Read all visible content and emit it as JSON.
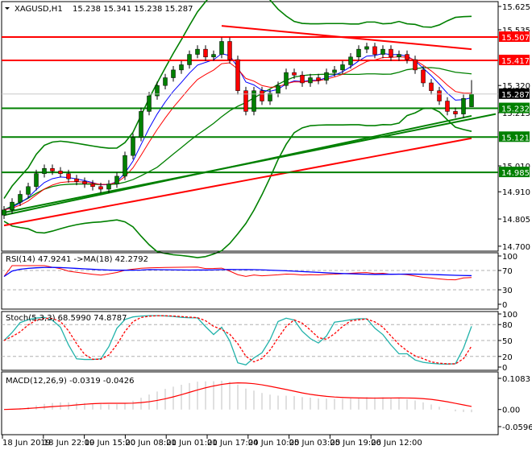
{
  "header": {
    "symbol": "XAGUSD,H1",
    "ohlc": "15.238 15.341 15.238 15.287"
  },
  "colors": {
    "bull": "#008000",
    "bear": "#ff0000",
    "support": "#008000",
    "resistance": "#ff0000",
    "bollinger": "#008000",
    "ma_fast": "#0000ff",
    "ma_slow": "#ff0000",
    "stoch_main": "#20b2aa",
    "stoch_signal": "#ff0000",
    "macd_hist": "#c0c0c0",
    "macd_signal": "#ff0000"
  },
  "chart_data": {
    "type": "candlestick",
    "title": "XAGUSD,H1",
    "ylim": [
      14.7,
      15.625
    ],
    "price_ticks": [
      "15.625",
      "15.535",
      "15.320",
      "15.215",
      "15.010",
      "14.910",
      "14.805",
      "14.700"
    ],
    "x_tick_labels": [
      "18 Jun 2019",
      "18 Jun 22:00",
      "19 Jun 15:00",
      "20 Jun 08:00",
      "21 Jun 01:00",
      "21 Jun 17:00",
      "24 Jun 10:00",
      "25 Jun 03:00",
      "25 Jun 19:00",
      "26 Jun 12:00"
    ],
    "closes": [
      14.84,
      14.87,
      14.9,
      14.93,
      14.98,
      15.0,
      14.99,
      14.98,
      14.96,
      14.95,
      14.94,
      14.93,
      14.92,
      14.94,
      14.97,
      15.05,
      15.12,
      15.22,
      15.28,
      15.32,
      15.35,
      15.38,
      15.4,
      15.44,
      15.46,
      15.43,
      15.44,
      15.49,
      15.42,
      15.3,
      15.22,
      15.3,
      15.26,
      15.29,
      15.32,
      15.37,
      15.36,
      15.33,
      15.35,
      15.34,
      15.37,
      15.38,
      15.4,
      15.43,
      15.46,
      15.47,
      15.44,
      15.46,
      15.43,
      15.44,
      15.42,
      15.38,
      15.33,
      15.3,
      15.26,
      15.22,
      15.21,
      15.27,
      15.287
    ],
    "last_bar": {
      "open": 15.238,
      "high": 15.341,
      "low": 15.238,
      "close": 15.287
    },
    "current_price": "15.287",
    "levels": [
      {
        "value": 15.507,
        "label": "15.507",
        "kind": "resistance"
      },
      {
        "value": 15.417,
        "label": "15.417",
        "kind": "resistance"
      },
      {
        "value": 15.232,
        "label": "15.232",
        "kind": "support"
      },
      {
        "value": 15.121,
        "label": "15.121",
        "kind": "support"
      },
      {
        "value": 14.985,
        "label": "14.985",
        "kind": "support"
      }
    ],
    "trendlines": [
      {
        "kind": "resistance",
        "from_bar": 27,
        "from_price": 15.55,
        "to_bar": 58,
        "to_price": 15.46
      },
      {
        "kind": "support",
        "from_bar": 0,
        "from_price": 14.83,
        "to_bar": 61,
        "to_price": 15.21
      }
    ],
    "rsi": {
      "label": "RSI(14) 47.9241  ->MA(18) 42.2792",
      "ticks": [
        "100",
        "70",
        "30",
        "0"
      ]
    },
    "stoch": {
      "label": "Stoch(5,3,3) 68.5990 74.8787",
      "ticks": [
        "100",
        "80",
        "50",
        "20",
        "0"
      ]
    },
    "macd": {
      "label": "MACD(12,26,9) -0.0319 -0.0426",
      "ticks": [
        "0.1083",
        "0.00",
        "-0.0596"
      ]
    }
  }
}
